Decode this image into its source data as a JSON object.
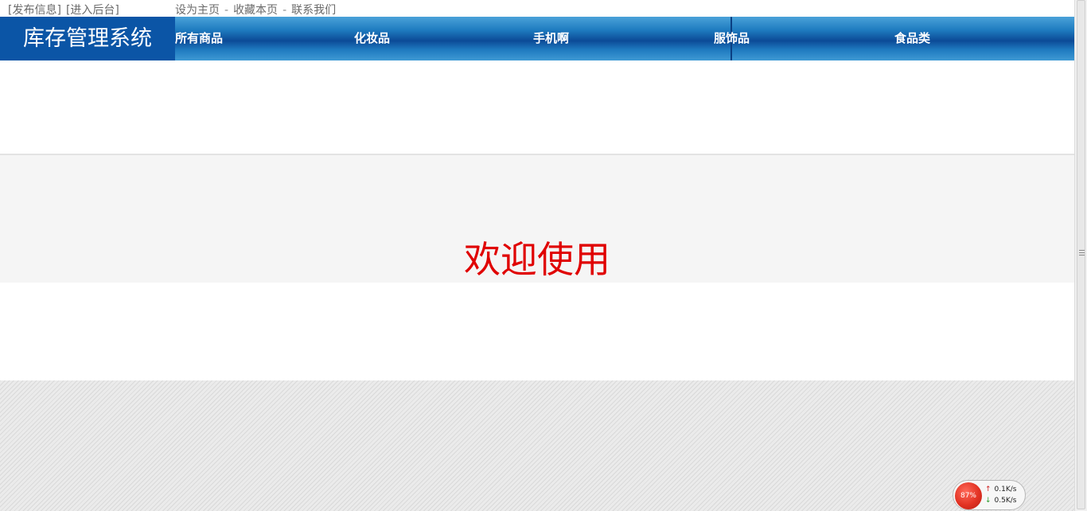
{
  "topbar": {
    "publish_link": "[发布信息]",
    "admin_link": "[进入后台]",
    "set_home": "设为主页",
    "bookmark": "收藏本页",
    "contact": "联系我们",
    "separator": "-"
  },
  "header": {
    "logo_text": "库存管理系统",
    "nav": [
      {
        "label": "所有商品"
      },
      {
        "label": "化妆品"
      },
      {
        "label": "手机啊"
      },
      {
        "label": "服饰品"
      },
      {
        "label": "食品类"
      }
    ]
  },
  "main": {
    "welcome_text": "欢迎使用"
  },
  "net_monitor": {
    "percent": "87%",
    "upload": "0.1K/s",
    "download": "0.5K/s",
    "up_arrow": "↑",
    "down_arrow": "↓"
  },
  "colors": {
    "logo_bg": "#0b55a6",
    "nav_blue": "#1f7cc0",
    "welcome_red": "#e00000"
  }
}
